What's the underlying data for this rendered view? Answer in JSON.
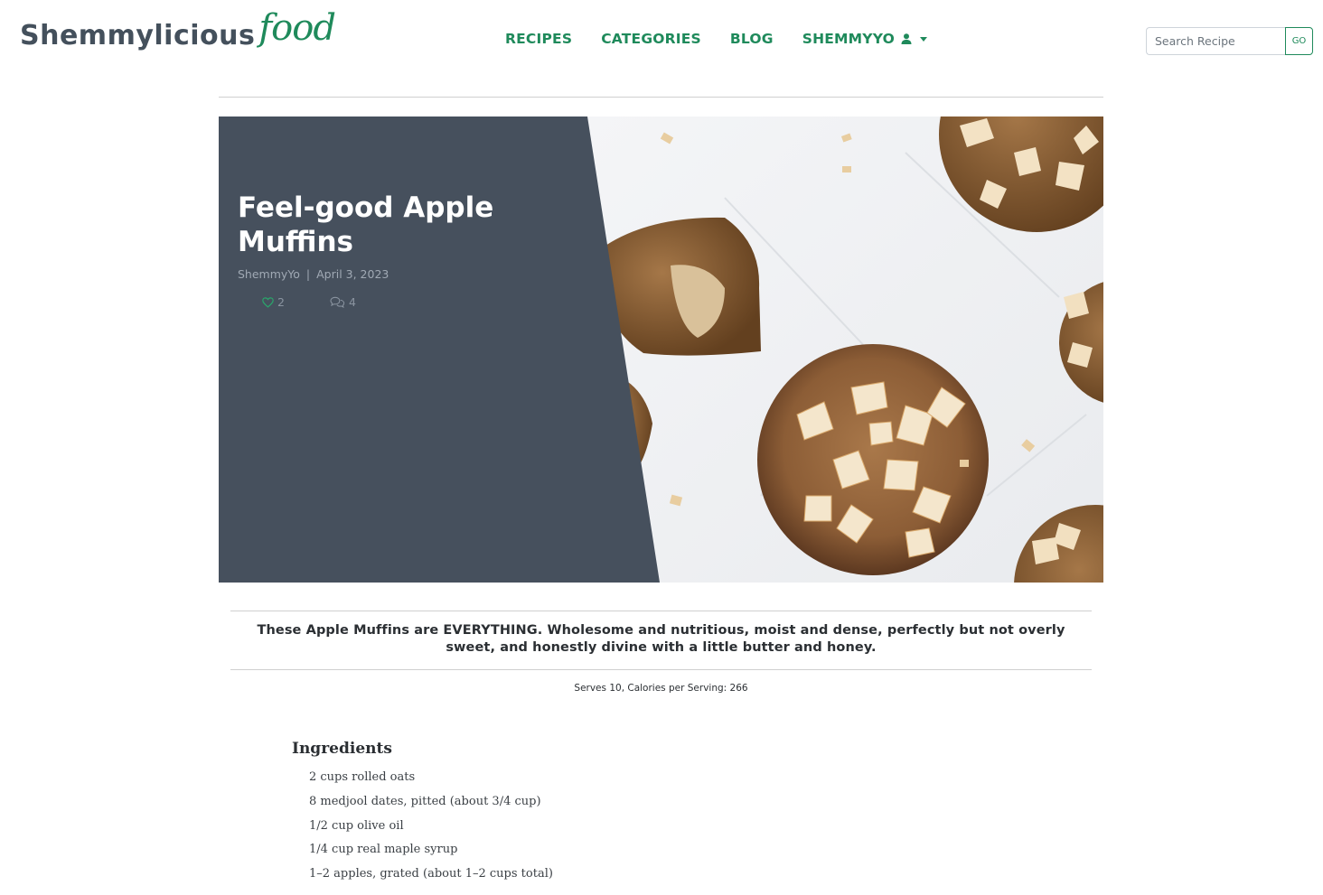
{
  "site": {
    "logo_main": "Shemmylicious",
    "logo_script": "food"
  },
  "nav": {
    "items": [
      "RECIPES",
      "CATEGORIES",
      "BLOG"
    ],
    "user_label": "SHEMMYYO",
    "accent_color": "#1f8a5b"
  },
  "search": {
    "placeholder": "Search Recipe",
    "button_label": "GO"
  },
  "recipe": {
    "title": "Feel-good Apple Muffins",
    "author": "ShemmyYo",
    "separator": "|",
    "date": "April 3, 2023",
    "likes": "2",
    "comments": "4",
    "summary": "These Apple Muffins are EVERYTHING. Wholesome and nutritious, moist and dense, perfectly but not overly sweet, and honestly divine with a little butter and honey.",
    "serves_line": "Serves 10, Calories per Serving: 266",
    "ingredients_title": "Ingredients",
    "ingredients": [
      "2 cups rolled oats",
      "8 medjool dates, pitted (about 3/4 cup)",
      "1/2 cup olive oil",
      "1/4 cup real maple syrup",
      "1–2 apples, grated (about 1–2 cups total)"
    ]
  },
  "icons": {
    "user": "user-icon",
    "caret": "chevron-down-icon",
    "like": "heart-icon",
    "comment": "comment-icon"
  }
}
